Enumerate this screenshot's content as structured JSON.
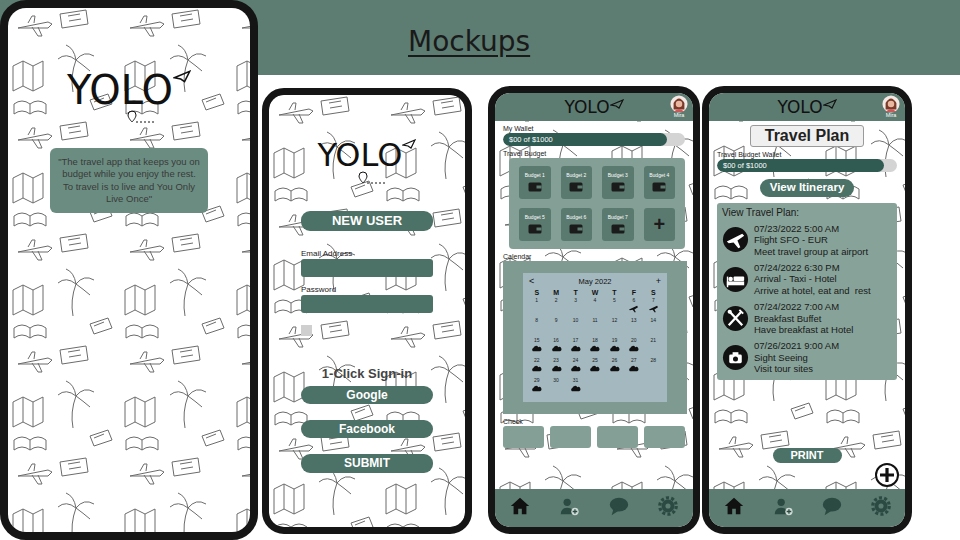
{
  "slide": {
    "title": "Mockups"
  },
  "splash": {
    "logo": "YOLO",
    "tagline": "\"The travel app that keeps you on budget while you enjoy the rest. To travel is to live and You Only Live Once\""
  },
  "login": {
    "logo": "YOLO",
    "new_user": "NEW USER",
    "fields": [
      {
        "label": "Email Address"
      },
      {
        "label": "Password"
      }
    ],
    "remember": {
      "checked": false
    },
    "one_click": "1-Click Sign-in",
    "providers": [
      "Google",
      "Facebook"
    ],
    "submit": "SUBMIT"
  },
  "dashboard": {
    "logo": "YOLO",
    "user": "Mira",
    "wallet": {
      "label": "My Wallet",
      "reading": "$00 of $1000",
      "level": 0.9
    },
    "budget": {
      "label": "Travel Budget",
      "tiles": [
        {
          "label": "Budget 1"
        },
        {
          "label": "Budget 2"
        },
        {
          "label": "Budget 3"
        },
        {
          "label": "Budget 4"
        },
        {
          "label": "Budget 5"
        },
        {
          "label": "Budget 6"
        },
        {
          "label": "Budget 7"
        }
      ],
      "add": "+"
    },
    "calendar": {
      "label": "Calendar",
      "prev": "<",
      "month": "May 2022",
      "add": "+",
      "weekdays": [
        "S",
        "M",
        "T",
        "W",
        "T",
        "F",
        "S"
      ],
      "days": [
        {
          "day": "1",
          "kind": "plain"
        },
        {
          "day": "2",
          "kind": "plain"
        },
        {
          "day": "3",
          "kind": "plain"
        },
        {
          "day": "4",
          "kind": "plain"
        },
        {
          "day": "5",
          "kind": "plain"
        },
        {
          "day": "6",
          "kind": "flight"
        },
        {
          "day": "7",
          "kind": "flight"
        },
        {
          "day": "8",
          "kind": "plain"
        },
        {
          "day": "9",
          "kind": "plain"
        },
        {
          "day": "10",
          "kind": "plain"
        },
        {
          "day": "11",
          "kind": "plain"
        },
        {
          "day": "12",
          "kind": "plain"
        },
        {
          "day": "13",
          "kind": "plain"
        },
        {
          "day": "14",
          "kind": "plain"
        },
        {
          "day": "15",
          "kind": "weather"
        },
        {
          "day": "16",
          "kind": "weather"
        },
        {
          "day": "17",
          "kind": "weather"
        },
        {
          "day": "18",
          "kind": "weather"
        },
        {
          "day": "19",
          "kind": "weather"
        },
        {
          "day": "20",
          "kind": "weather"
        },
        {
          "day": "21",
          "kind": "plain"
        },
        {
          "day": "22",
          "kind": "weather"
        },
        {
          "day": "23",
          "kind": "weather"
        },
        {
          "day": "24",
          "kind": "weather"
        },
        {
          "day": "25",
          "kind": "weather"
        },
        {
          "day": "26",
          "kind": "weather"
        },
        {
          "day": "27",
          "kind": "weather"
        },
        {
          "day": "28",
          "kind": "plain"
        },
        {
          "day": "29",
          "kind": "weather"
        },
        {
          "day": "30",
          "kind": "plain"
        },
        {
          "day": "31",
          "kind": "weather"
        }
      ]
    },
    "checklist": {
      "label": "Check"
    },
    "nav": [
      {
        "kind": "home",
        "selected": true
      },
      {
        "kind": "add-user",
        "selected": false
      },
      {
        "kind": "chat",
        "selected": false
      },
      {
        "kind": "settings",
        "selected": false
      }
    ]
  },
  "travel_plan": {
    "logo": "YOLO",
    "user": "Mira",
    "title": "Travel Plan",
    "wallet": {
      "label": "Travel Budget Wallet",
      "reading": "$00 of $1000",
      "level": 0.93
    },
    "itinerary_button": "View Itinerary",
    "plan": {
      "heading": "View Travel Plan:",
      "entries": [
        {
          "kind": "flight",
          "time": "07/23/2022 5:00 AM",
          "title": "Flight SFO - EUR",
          "note": "Meet travel group at airport"
        },
        {
          "kind": "hotel",
          "time": "07/24/2022 6:30 PM",
          "title": "Arrival - Taxi - Hotel",
          "note": "Arrive at hotel, eat and  rest"
        },
        {
          "kind": "meal",
          "time": "07/24/2022 7:00 AM",
          "title": "Breakfast Buffet",
          "note": "Have breakfast at Hotel"
        },
        {
          "kind": "camera",
          "time": "07/26/2021 9:00 AM",
          "title": "Sight Seeing",
          "note": "Visit tour sites"
        }
      ]
    },
    "print": "PRINT",
    "nav": [
      {
        "kind": "home",
        "selected": true
      },
      {
        "kind": "add-user",
        "selected": false
      },
      {
        "kind": "chat",
        "selected": false
      },
      {
        "kind": "settings",
        "selected": false
      }
    ]
  }
}
